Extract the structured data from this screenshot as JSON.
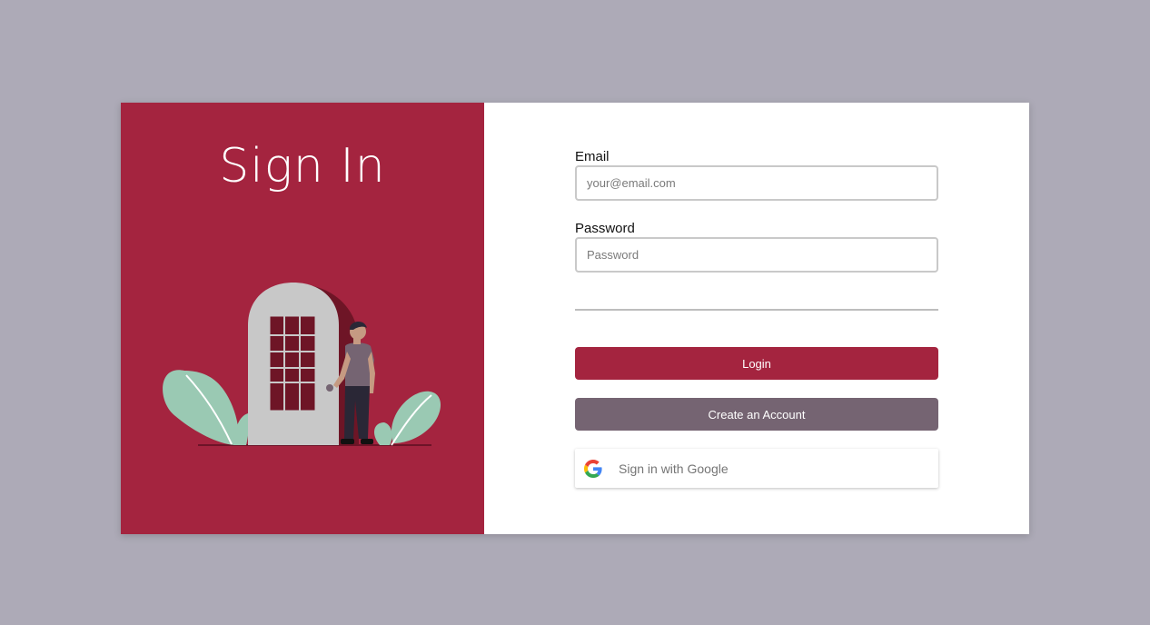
{
  "left": {
    "title": "Sign In"
  },
  "form": {
    "email_label": "Email",
    "email_placeholder": "your@email.com",
    "password_label": "Password",
    "password_placeholder": "Password"
  },
  "buttons": {
    "login": "Login",
    "create_account": "Create an Account",
    "google": "Sign in with Google"
  },
  "colors": {
    "background": "#adaab7",
    "brand": "#a4243f",
    "secondary": "#756472",
    "leaf": "#9ac9b3",
    "door": "#c8c8c8"
  },
  "icons": {
    "google": "google-g-icon"
  }
}
